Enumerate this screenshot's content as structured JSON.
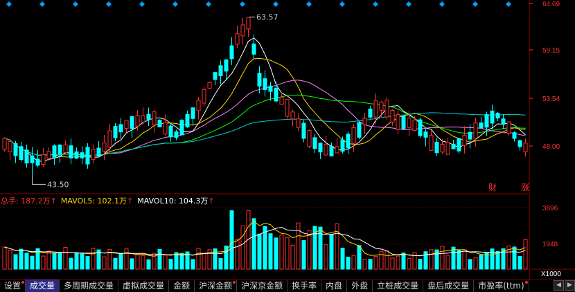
{
  "price_axis": {
    "labels": [
      "64.69",
      "59.15",
      "53.54",
      "48.00"
    ],
    "color": "#ff3c3c"
  },
  "volume_axis": {
    "labels": [
      "3896",
      "1948",
      "X1000"
    ]
  },
  "annotations": {
    "high": "63.57",
    "low": "43.50",
    "mark_cai": "财",
    "mark_zhang": "涨"
  },
  "volume_legend": {
    "total": {
      "label": "总手: 187.2万",
      "color": "#ff3030"
    },
    "mavol5": {
      "label": "MAVOL5: 102.1万",
      "color": "#ffd700"
    },
    "mavol10": {
      "label": "MAVOL10: 104.3万",
      "color": "#ffffff"
    },
    "arrow": "↑"
  },
  "tabs": [
    {
      "label": "设置",
      "active": false,
      "dot": true
    },
    {
      "label": "成交量",
      "active": true,
      "dot": false
    },
    {
      "label": "多周期成交量",
      "active": false,
      "dot": false
    },
    {
      "label": "虚拟成交量",
      "active": false,
      "dot": false
    },
    {
      "label": "金额",
      "active": false,
      "dot": false
    },
    {
      "label": "沪深金额",
      "active": false,
      "dot": true
    },
    {
      "label": "沪深京金额",
      "active": false,
      "dot": false
    },
    {
      "label": "换手率",
      "active": false,
      "dot": false
    },
    {
      "label": "内盘",
      "active": false,
      "dot": false
    },
    {
      "label": "外盘",
      "active": false,
      "dot": false
    },
    {
      "label": "立桩成交量",
      "active": false,
      "dot": false
    },
    {
      "label": "盘后成交量",
      "active": false,
      "dot": false
    },
    {
      "label": "市盈率(ttm)",
      "active": false,
      "dot": true
    }
  ],
  "nav": {
    "left": "◀",
    "right": "▶"
  },
  "colors": {
    "up": "#ff3030",
    "down": "#00ffff",
    "ma5": "#ffffff",
    "ma10": "#ffd700",
    "ma20": "#ff80ff",
    "ma30": "#00ff00",
    "ma60": "#00d0d0",
    "axis": "#8a0000",
    "diamond": "#00a0ff"
  }
}
